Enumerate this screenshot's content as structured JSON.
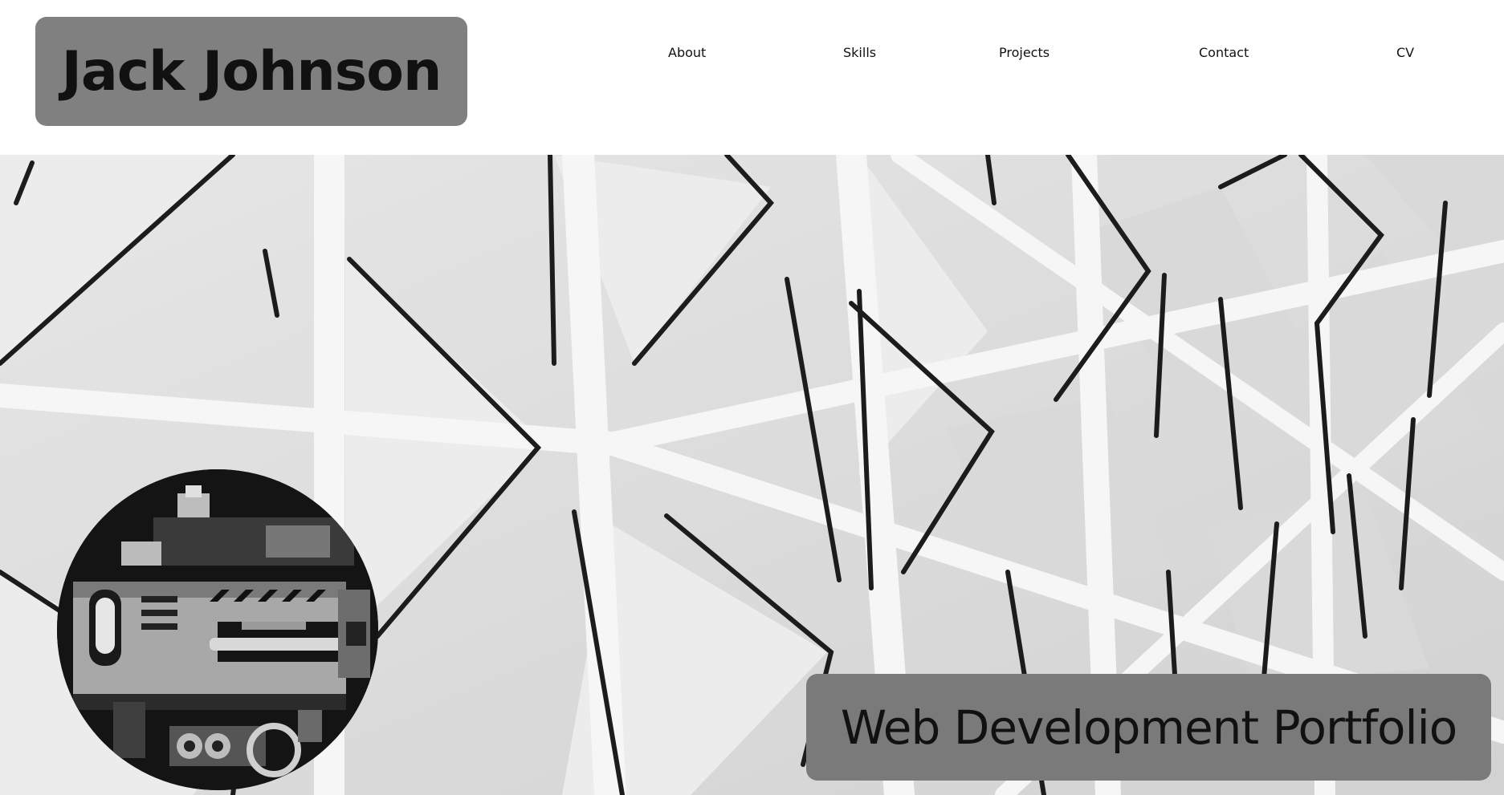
{
  "header": {
    "brand_name": "Jack Johnson",
    "nav": [
      {
        "label": "About"
      },
      {
        "label": "Skills"
      },
      {
        "label": "Projects"
      },
      {
        "label": "Contact"
      },
      {
        "label": "CV"
      }
    ]
  },
  "hero": {
    "background": "white geometric triangular lattice pattern",
    "avatar_icon": "pixel-robot-avatar-icon",
    "tagline": "Web Development Portfolio"
  },
  "colors": {
    "label_box": "#808080",
    "text": "#111111",
    "header_bg": "#ffffff"
  }
}
